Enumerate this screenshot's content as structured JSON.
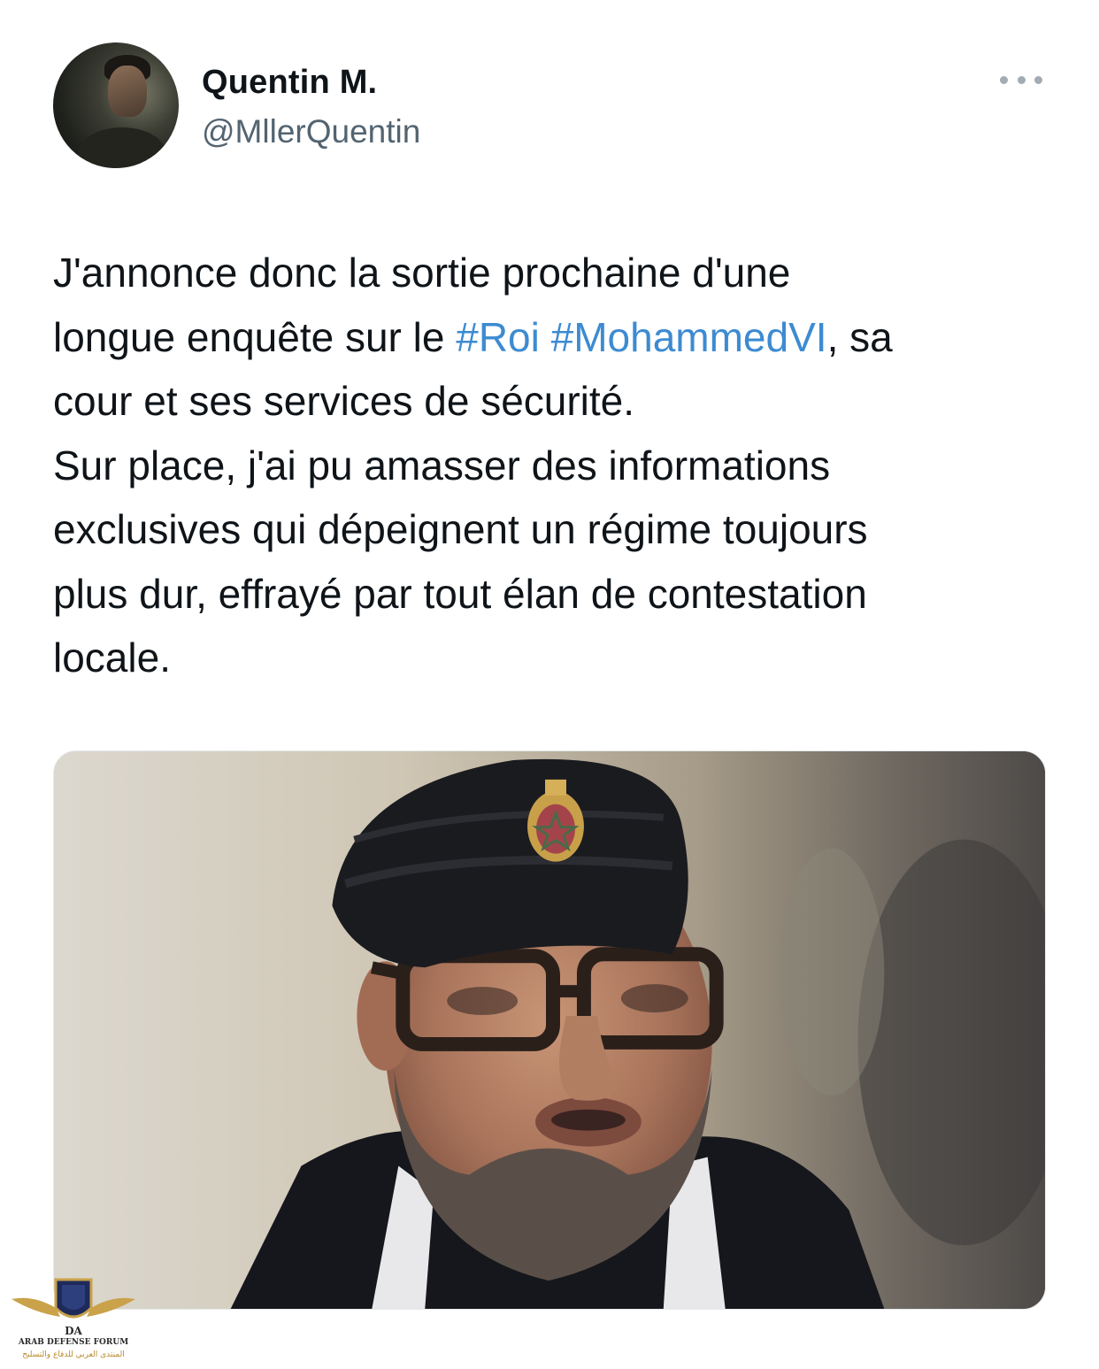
{
  "tweet": {
    "author": {
      "name": "Quentin M.",
      "handle": "@MllerQuentin"
    },
    "text_lines": [
      {
        "before": "J'annonce donc la sortie prochaine d'une",
        "tag1": "",
        "space": "",
        "tag2": "",
        "after": ""
      },
      {
        "before": "longue enquête sur le ",
        "tag1": "#Roi",
        "space": " ",
        "tag2": "#MohammedVI",
        "after": ", sa"
      },
      {
        "before": "cour et ses services de sécurité.",
        "tag1": "",
        "space": "",
        "tag2": "",
        "after": ""
      },
      {
        "before": "Sur place, j'ai pu amasser des informations",
        "tag1": "",
        "space": "",
        "tag2": "",
        "after": ""
      },
      {
        "before": "exclusives qui dépeignent un régime toujours",
        "tag1": "",
        "space": "",
        "tag2": "",
        "after": ""
      },
      {
        "before": "plus dur, effrayé par tout élan de contestation",
        "tag1": "",
        "space": "",
        "tag2": "",
        "after": ""
      },
      {
        "before": "locale.",
        "tag1": "",
        "space": "",
        "tag2": "",
        "after": ""
      }
    ],
    "hashtag_color": "#3d8bd1",
    "more_icon": "ellipsis-icon"
  },
  "watermark": {
    "line1": "ARAB DEFENSE FORUM",
    "line2": "المنتدى العربي للدفاع والتسليح"
  }
}
